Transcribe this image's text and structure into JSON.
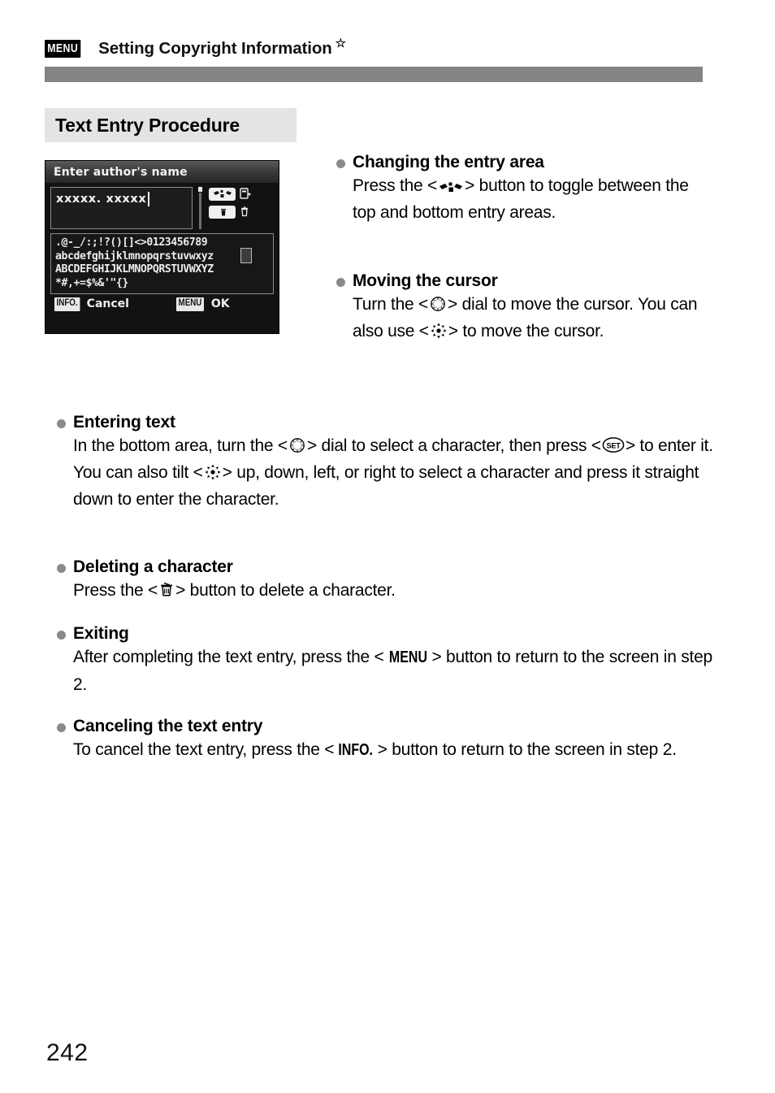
{
  "header": {
    "menu_badge": "MENU",
    "title": "Setting Copyright Information",
    "star": "☆"
  },
  "section": {
    "heading": "Text Entry Procedure"
  },
  "camera_screen": {
    "title": "Enter author's name",
    "entry_value": "xxxxx. xxxxx",
    "toggle_area_icon": "entry-area-toggle-icon",
    "delete_icon": "trash-icon",
    "character_rows": [
      ".@-_/:;!?()[]<>0123456789",
      "abcdefghijklmnopqrstuvwxyz",
      "ABCDEFGHIJKLMNOPQRSTUVWXYZ",
      "*#,+=$%&'\"{}"
    ],
    "selected_character": "x",
    "footer": {
      "cancel_badge": "INFO.",
      "cancel_label": "Cancel",
      "ok_badge": "MENU",
      "ok_label": "OK"
    }
  },
  "sections": [
    {
      "id": "changing-entry-area",
      "title": "Changing the entry area",
      "text_before": "Press the <",
      "icon": "entry-area-toggle-icon",
      "text_after": "> button to toggle between the top and bottom entry areas."
    },
    {
      "id": "moving-cursor",
      "title": "Moving the cursor",
      "text_1": "Turn the <",
      "icon_1": "quick-control-dial-icon",
      "text_2": "> dial to move the cursor. You can also use <",
      "icon_2": "multi-controller-icon",
      "text_3": "> to move the cursor."
    },
    {
      "id": "entering-text",
      "title": "Entering text",
      "text_1": "In the bottom area, turn the <",
      "icon_1": "quick-control-dial-icon",
      "text_2": "> dial to select a character, then press <",
      "icon_2": "set-button-icon",
      "text_3": "> to enter it. You can also tilt <",
      "icon_3": "multi-controller-icon",
      "text_4": "> up, down, left, or right to select a character and press it straight down to enter the character."
    },
    {
      "id": "deleting-character",
      "title": "Deleting a character",
      "text_1": "Press the <",
      "icon_1": "trash-icon",
      "text_2": "> button to delete a character."
    },
    {
      "id": "exiting",
      "title": "Exiting",
      "text_1": "After completing the text entry, press the <",
      "key_1": "MENU",
      "text_2": "> button to return to the screen in step 2."
    },
    {
      "id": "canceling-text-entry",
      "title": "Canceling the text entry",
      "text_1": "To cancel the text entry, press the <",
      "key_1": "INFO.",
      "text_2": "> button to return to the screen in step 2."
    }
  ],
  "footer": {
    "page_number": "242"
  },
  "colors": {
    "rule_gray": "#848484",
    "section_box_gray": "#e4e4e4",
    "bullet_gray": "#8a8a8a",
    "lcd_background": "#121212"
  }
}
